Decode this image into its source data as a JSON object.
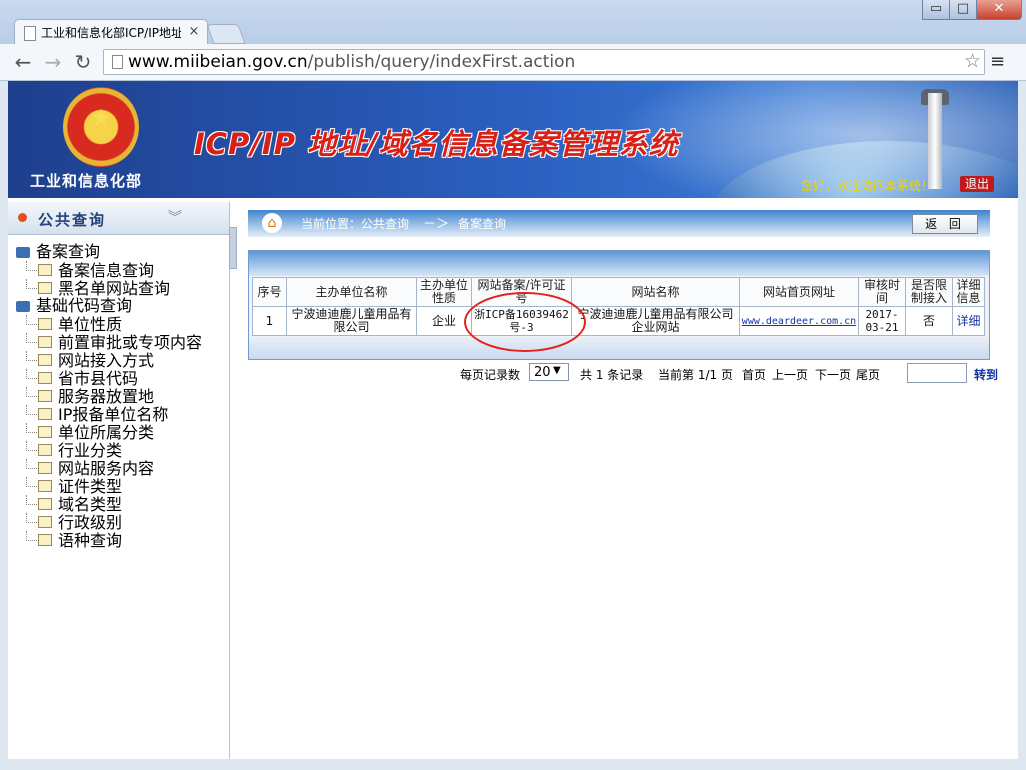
{
  "browser": {
    "tab_title": "工业和信息化部ICP/IP地址",
    "tab_close": "×",
    "url_host": "www.miibeian.gov.cn",
    "url_path": "/publish/query/indexFirst.action",
    "window_controls": {
      "minimize": "▭",
      "maximize": "□",
      "close": "✕"
    }
  },
  "header": {
    "ministry_name": "工业和信息化部",
    "system_title": "ICP/IP 地址/域名信息备案管理系统",
    "greeting": "您好，欢迎访问本系统！",
    "logout": "退出"
  },
  "sidebar": {
    "title": "公共查询",
    "groups": [
      {
        "label": "备案查询",
        "items": [
          "备案信息查询",
          "黑名单网站查询"
        ]
      },
      {
        "label": "基础代码查询",
        "items": [
          "单位性质",
          "前置审批或专项内容",
          "网站接入方式",
          "省市县代码",
          "服务器放置地",
          "IP报备单位名称",
          "单位所属分类",
          "行业分类",
          "网站服务内容",
          "证件类型",
          "域名类型",
          "行政级别",
          "语种查询"
        ]
      }
    ]
  },
  "breadcrumb": {
    "label": "当前位置：公共查询",
    "arrow": "－＞",
    "current": "备案查询",
    "return_button": "返 回"
  },
  "table": {
    "headers": [
      "序号",
      "主办单位名称",
      "主办单位性质",
      "网站备案/许可证号",
      "网站名称",
      "网站首页网址",
      "审核时间",
      "是否限制接入",
      "详细信息"
    ],
    "rows": [
      {
        "index": "1",
        "owner": "宁波迪迪鹿儿童用品有限公司",
        "owner_type": "企业",
        "license": "浙ICP备16039462号-3",
        "site_name": "宁波迪迪鹿儿童用品有限公司企业网站",
        "url": "www.deardeer.com.cn",
        "audit_date": "2017-03-21",
        "restricted": "否",
        "detail": "详细"
      }
    ]
  },
  "pager": {
    "per_page_label": "每页记录数",
    "per_page_value": "20",
    "total": "共 1 条记录",
    "current": "当前第 1/1 页",
    "first": "首页",
    "prev": "上一页",
    "next": "下一页",
    "last": "尾页",
    "goto": "转到"
  },
  "colors": {
    "banner": "#2b5fbf",
    "title_red": "#d92017",
    "link": "#1434a4",
    "annotation": "#e2231a"
  }
}
